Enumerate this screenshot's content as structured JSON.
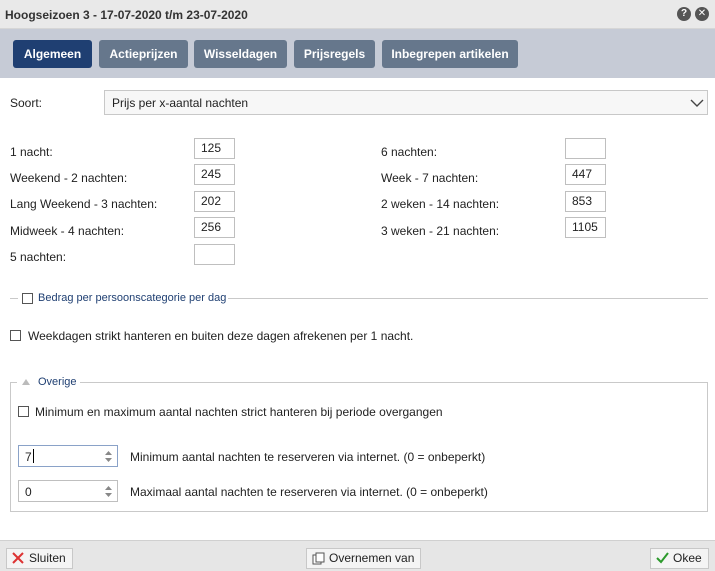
{
  "window": {
    "title": "Hoogseizoen 3 - 17-07-2020 t/m 23-07-2020"
  },
  "tabs": [
    {
      "label": "Algemeen"
    },
    {
      "label": "Actieprijzen"
    },
    {
      "label": "Wisseldagen"
    },
    {
      "label": "Prijsregels"
    },
    {
      "label": "Inbegrepen artikelen"
    }
  ],
  "soort": {
    "label": "Soort:",
    "value": "Prijs per x-aantal nachten"
  },
  "prices_left": [
    {
      "label": "1 nacht:",
      "value": "125"
    },
    {
      "label": "Weekend - 2 nachten:",
      "value": "245"
    },
    {
      "label": "Lang Weekend - 3 nachten:",
      "value": "202"
    },
    {
      "label": "Midweek - 4 nachten:",
      "value": "256"
    },
    {
      "label": "5 nachten:",
      "value": ""
    }
  ],
  "prices_right": [
    {
      "label": "6 nachten:",
      "value": ""
    },
    {
      "label": "Week - 7 nachten:",
      "value": "447"
    },
    {
      "label": "2 weken - 14 nachten:",
      "value": "853"
    },
    {
      "label": "3 weken - 21 nachten:",
      "value": "1105"
    }
  ],
  "persons": {
    "label": "Bedrag per persoonscategorie per dag"
  },
  "weekdays": {
    "label": "Weekdagen strikt hanteren en buiten deze dagen afrekenen per 1 nacht."
  },
  "overige": {
    "legend": "Overige",
    "strict_label": "Minimum en maximum aantal nachten strict hanteren bij periode overgangen",
    "min_value": "7",
    "min_label": "Minimum aantal nachten te reserveren via internet. (0 = onbeperkt)",
    "max_value": "0",
    "max_label": "Maximaal aantal nachten te reserveren via internet. (0 = onbeperkt)"
  },
  "footer": {
    "close": "Sluiten",
    "copy": "Overnemen van",
    "ok": "Okee"
  },
  "colors": {
    "tab_active": "#1f3f72",
    "tab_inactive": "#66778c",
    "link_blue": "#1f3f72"
  }
}
